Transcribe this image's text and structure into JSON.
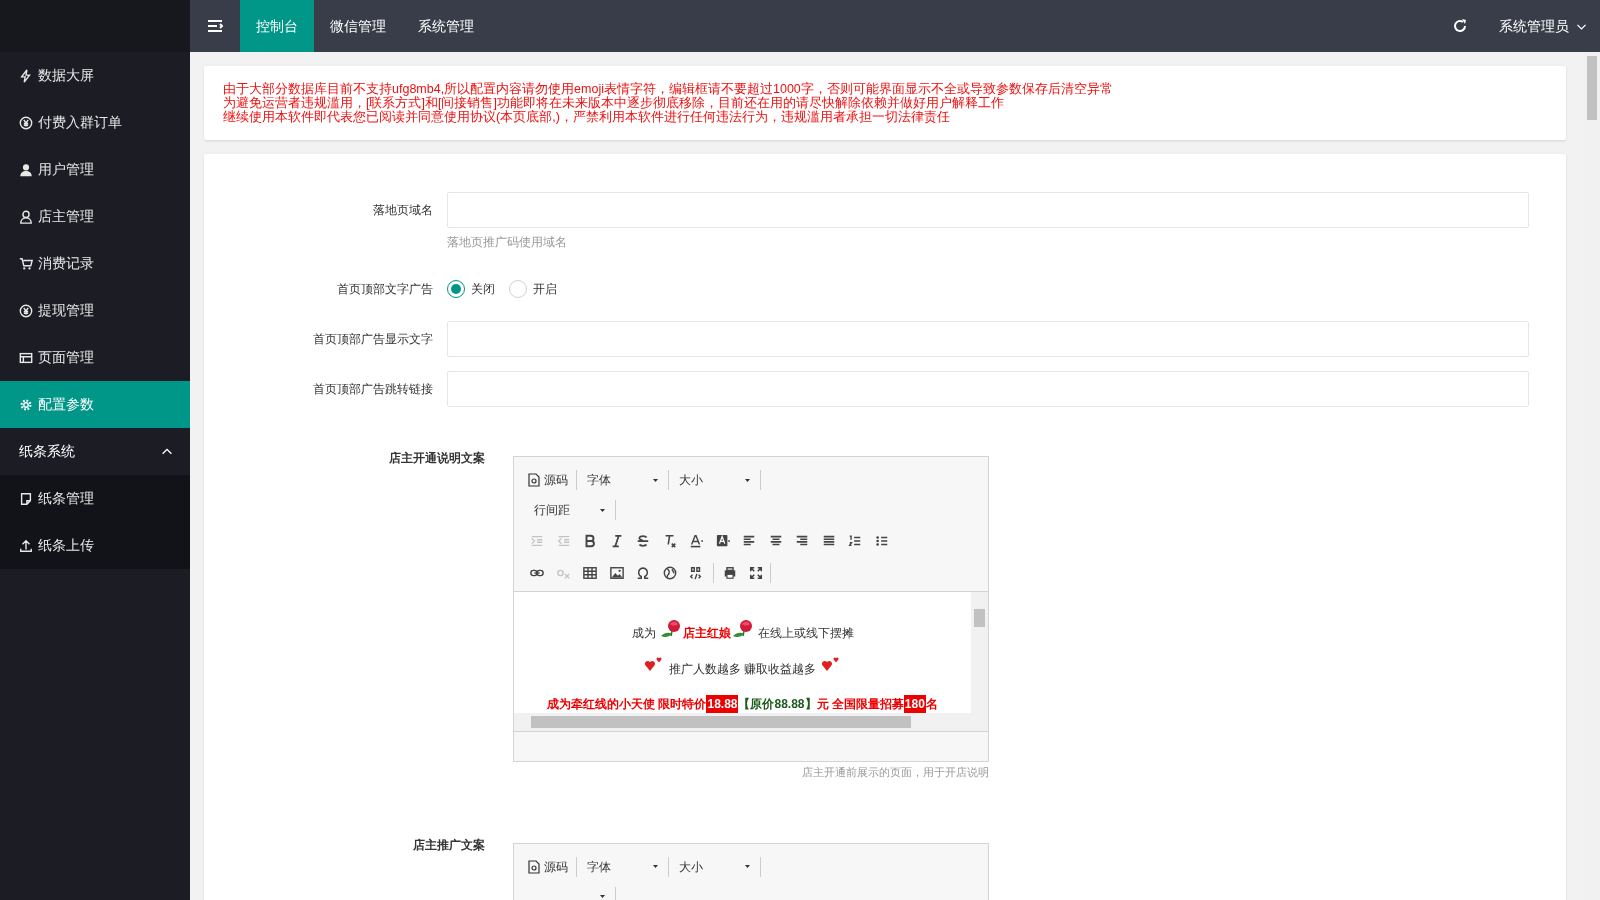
{
  "header": {
    "tabs": [
      {
        "label": "控制台",
        "selected": true
      },
      {
        "label": "微信管理",
        "selected": false
      },
      {
        "label": "系统管理",
        "selected": false
      }
    ],
    "user": "系统管理员"
  },
  "sidebar": {
    "items": [
      {
        "label": "数据大屏",
        "selected": false
      },
      {
        "label": "付费入群订单",
        "selected": false
      },
      {
        "label": "用户管理",
        "selected": false
      },
      {
        "label": "店主管理",
        "selected": false
      },
      {
        "label": "消费记录",
        "selected": false
      },
      {
        "label": "提现管理",
        "selected": false
      },
      {
        "label": "页面管理",
        "selected": false
      },
      {
        "label": "配置参数",
        "selected": true
      },
      {
        "label": "纸条系统",
        "expanded": true,
        "children": [
          {
            "label": "纸条管理",
            "selected": false
          },
          {
            "label": "纸条上传",
            "selected": false
          }
        ]
      }
    ]
  },
  "notice": [
    "由于大部分数据库目前不支持ufg8mb4,所以配置内容请勿使用emoji表情字符，编辑框请不要超过1000字，否则可能界面显示不全或导致参数保存后清空异常",
    "为避免运营者违规滥用，[联系方式]和[间接销售]功能即将在未来版本中逐步彻底移除，目前还在用的请尽快解除依赖并做好用户解释工作",
    "继续使用本软件即代表您已阅读并同意使用协议(本页底部,)，严禁利用本软件进行任何违法行为，违规滥用者承担一切法律责任"
  ],
  "form": {
    "fields": [
      {
        "kind": "text",
        "label": "落地页域名",
        "hint": "落地页推广码使用域名"
      },
      {
        "kind": "radio",
        "label": "首页顶部文字广告",
        "options": [
          {
            "label": "关闭",
            "selected": true
          },
          {
            "label": "开启",
            "selected": false
          }
        ]
      },
      {
        "kind": "text",
        "label": "首页顶部广告显示文字"
      },
      {
        "kind": "text",
        "label": "首页顶部广告跳转链接"
      }
    ],
    "editors": [
      {
        "label": "店主开通说明文案",
        "hint": "店主开通前展示的页面，用于开店说明",
        "toolbar": {
          "source": "源码",
          "font": "字体",
          "size": "大小",
          "line_height": "行间距"
        },
        "tools": [
          {
            "kind": "indent",
            "disabled": true
          },
          {
            "kind": "outdent",
            "disabled": true
          },
          {
            "kind": "bold",
            "disabled": false
          },
          {
            "kind": "italic",
            "disabled": false
          },
          {
            "kind": "strike",
            "disabled": false
          },
          {
            "kind": "clear",
            "disabled": false
          },
          {
            "kind": "color",
            "disabled": false
          },
          {
            "kind": "bgcolor",
            "disabled": false
          },
          {
            "kind": "left",
            "disabled": false
          },
          {
            "kind": "center",
            "disabled": false
          },
          {
            "kind": "right",
            "disabled": false
          },
          {
            "kind": "justify",
            "disabled": false
          },
          {
            "kind": "ol",
            "disabled": false
          },
          {
            "kind": "ul",
            "disabled": false
          },
          {
            "kind": "break"
          },
          {
            "kind": "link",
            "disabled": false
          },
          {
            "kind": "unlink",
            "disabled": true
          },
          {
            "kind": "table",
            "disabled": false
          },
          {
            "kind": "image",
            "disabled": false
          },
          {
            "kind": "omega",
            "disabled": false
          },
          {
            "kind": "globe",
            "disabled": false
          },
          {
            "kind": "code",
            "disabled": false
          },
          {
            "kind": "sep"
          },
          {
            "kind": "print",
            "disabled": false
          },
          {
            "kind": "fullscreen",
            "disabled": false
          }
        ],
        "content": [
          [
            {
              "kind": "plain",
              "text": "成为"
            },
            {
              "kind": "rose"
            },
            {
              "kind": "red",
              "text": "店主红娘"
            },
            {
              "kind": "rose"
            },
            {
              "kind": "plain",
              "text": "在线上或线下摆摊"
            }
          ],
          [
            {
              "kind": "heart"
            },
            {
              "kind": "plain",
              "text": "推广人数越多 赚取收益越多"
            },
            {
              "kind": "heart"
            }
          ],
          [
            {
              "kind": "red",
              "text": "成为牵红线的小天使 限时特价"
            },
            {
              "kind": "mark",
              "text": "18.88"
            },
            {
              "kind": "green",
              "text": "【原价88.88】"
            },
            {
              "kind": "red",
              "text": "元 全国限量招募"
            },
            {
              "kind": "mark",
              "text": "180"
            },
            {
              "kind": "red",
              "text": "名"
            }
          ]
        ]
      },
      {
        "label": "店主推广文案",
        "toolbar": {
          "source": "源码",
          "font": "字体",
          "size": "大小"
        }
      }
    ]
  }
}
